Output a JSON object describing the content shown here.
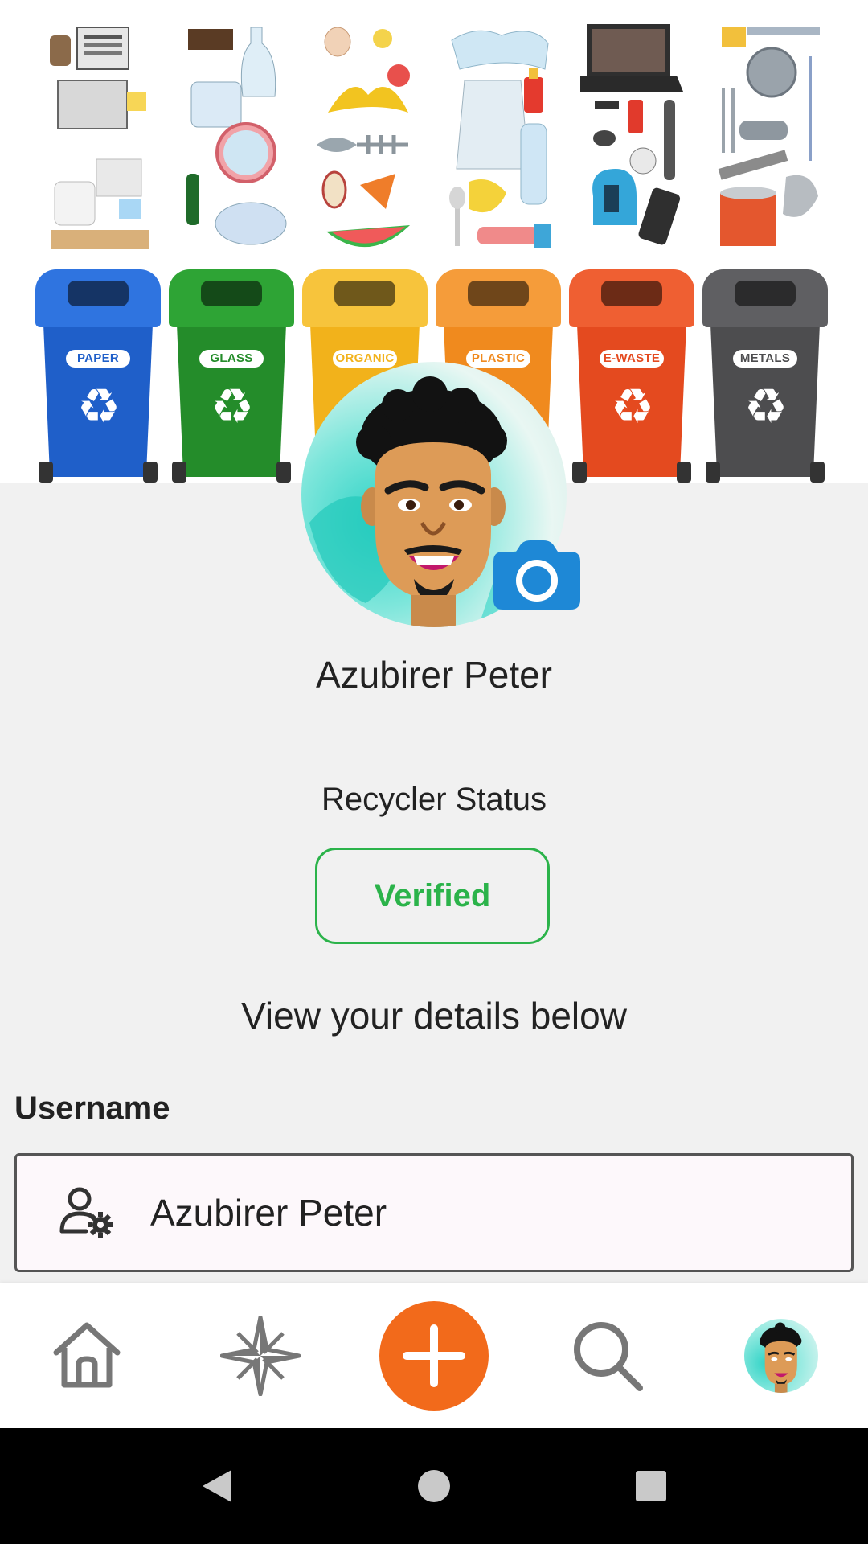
{
  "banner": {
    "bins": [
      {
        "label": "PAPER",
        "color": "#1f5fc9",
        "lid": "#2f74e0",
        "handle": "#173f86"
      },
      {
        "label": "GLASS",
        "color": "#248c2a",
        "lid": "#2ea435",
        "handle": "#1a5e1f"
      },
      {
        "label": "ORGANIC",
        "color": "#f2b21b",
        "lid": "#f7c43c",
        "handle": "#8a5b18"
      },
      {
        "label": "PLASTIC",
        "color": "#f08a1e",
        "lid": "#f59c3a",
        "handle": "#6b3a16"
      },
      {
        "label": "E-WASTE",
        "color": "#e44a1f",
        "lid": "#ef5f32",
        "handle": "#6e1e14"
      },
      {
        "label": "METALS",
        "color": "#4d4d4f",
        "lid": "#5f5f62",
        "handle": "#1e1e1f"
      }
    ]
  },
  "profile": {
    "name": "Azubirer Peter",
    "avatar": "cartoon-avatar",
    "camera_icon": "camera-icon"
  },
  "status": {
    "label": "Recycler Status",
    "badge": "Verified",
    "badge_color": "#2bb34a"
  },
  "details": {
    "heading": "View your details below",
    "fields": [
      {
        "label": "Username",
        "value": "Azubirer Peter",
        "icon": "user-gear-icon"
      }
    ]
  },
  "nav": {
    "items": [
      "home-icon",
      "compass-icon",
      "add-icon",
      "search-icon",
      "profile-avatar"
    ],
    "accent": "#f26a1b"
  }
}
